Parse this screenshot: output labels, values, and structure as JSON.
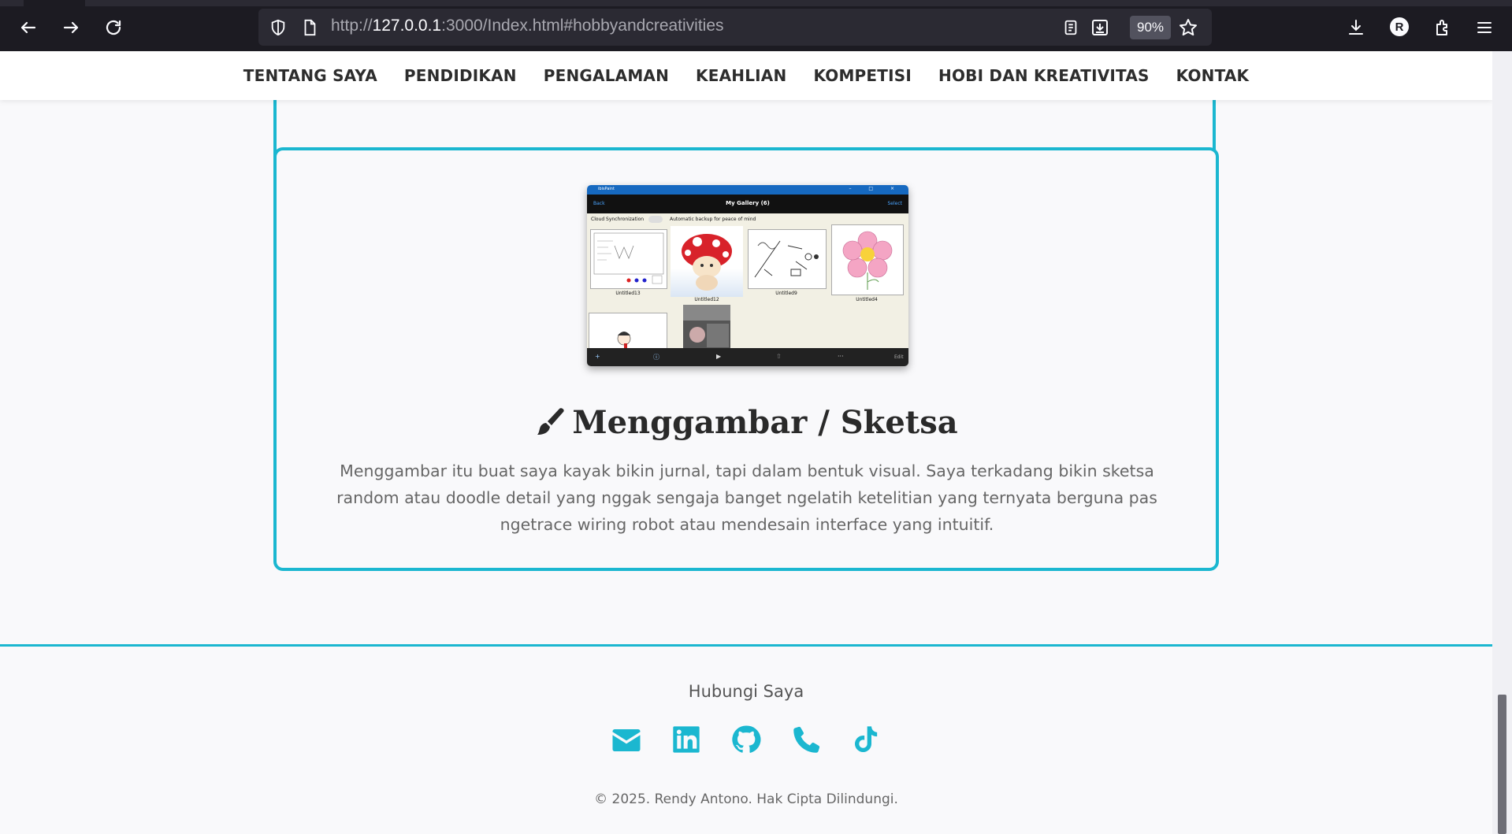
{
  "browser": {
    "url_prefix": "http://",
    "url_host": "127.0.0.1",
    "url_rest": ":3000/Index.html#hobbyandcreativities",
    "zoom": "90%",
    "profile_initial": "R"
  },
  "nav": {
    "items": [
      "TENTANG SAYA",
      "PENDIDIKAN",
      "PENGALAMAN",
      "KEAHLIAN",
      "KOMPETISI",
      "HOBI DAN KREATIVITAS",
      "KONTAK"
    ]
  },
  "hobby": {
    "title": "Menggambar / Sketsa",
    "icon": "paintbrush-icon",
    "description": "Menggambar itu buat saya kayak bikin jurnal, tapi dalam bentuk visual. Saya terkadang bikin sketsa random atau doodle detail yang nggak sengaja banget ngelatih ketelitian yang ternyata berguna pas ngetrace wiring robot atau mendesain interface yang intuitif.",
    "screenshot": {
      "app_name": "ibisPaint",
      "back": "Back",
      "gallery_title": "My Gallery (6)",
      "select": "Select",
      "sync": "Cloud Synchronization",
      "backup": "Automatic backup for peace of mind",
      "thumbs": [
        "Untitled13",
        "Untitled12",
        "Untitled9",
        "Untitled4"
      ],
      "edit": "Edit"
    }
  },
  "footer": {
    "title": "Hubungi Saya",
    "copyright": "© 2025. Rendy Antono. Hak Cipta Dilindungi.",
    "icons": [
      "envelope-icon",
      "linkedin-icon",
      "github-icon",
      "phone-icon",
      "tiktok-icon"
    ],
    "accent": "#1bb7d0"
  }
}
